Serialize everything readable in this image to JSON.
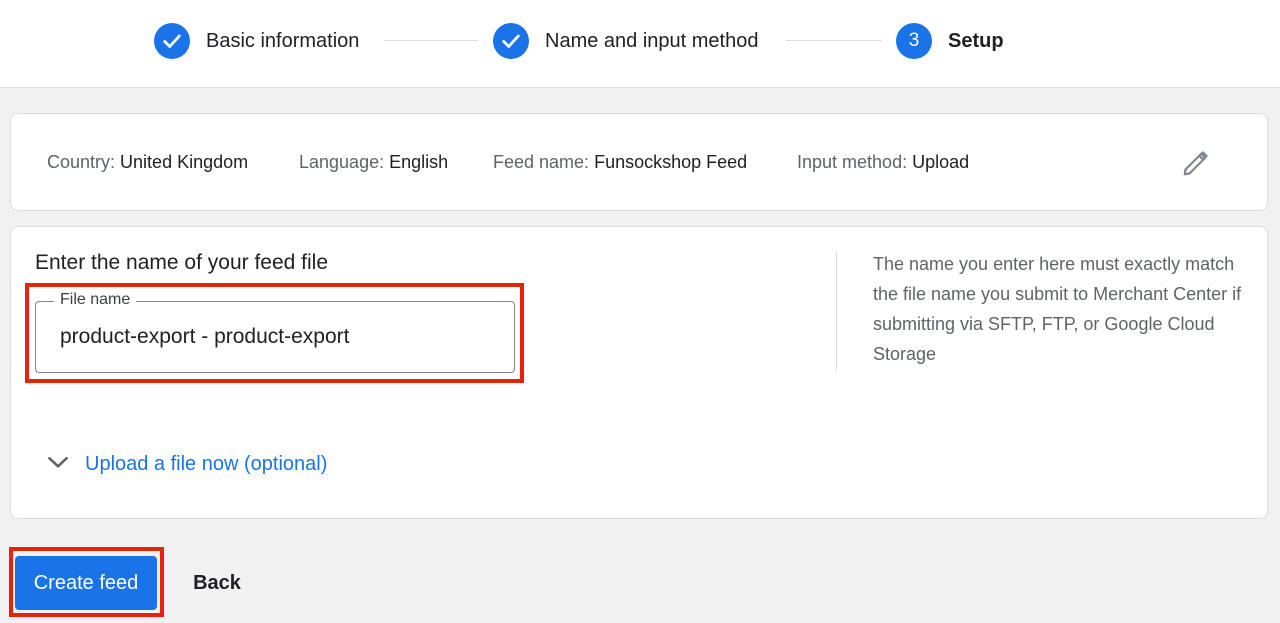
{
  "stepper": {
    "steps": [
      {
        "label": "Basic information",
        "state": "complete",
        "icon": "check-icon"
      },
      {
        "label": "Name and input method",
        "state": "complete",
        "icon": "check-icon"
      },
      {
        "label": "Setup",
        "number": "3",
        "state": "active"
      }
    ]
  },
  "summary": {
    "country": {
      "key": "Country:",
      "value": "United Kingdom"
    },
    "language": {
      "key": "Language:",
      "value": "English"
    },
    "feed_name": {
      "key": "Feed name:",
      "value": "Funsockshop Feed"
    },
    "input_method": {
      "key": "Input method:",
      "value": "Upload"
    },
    "edit_icon": "pencil-icon"
  },
  "main": {
    "title": "Enter the name of your feed file",
    "file_field": {
      "label": "File name",
      "value": "product-export - product-export"
    },
    "help_text": "The name you enter here must exactly match the file name you submit to Merchant Center if submitting via SFTP, FTP, or Google Cloud Storage",
    "expander": {
      "label": "Upload a file now (optional)",
      "icon": "chevron-down-icon"
    }
  },
  "actions": {
    "create_label": "Create feed",
    "back_label": "Back"
  },
  "colors": {
    "accent": "#1a73e8",
    "highlight": "#e8210b",
    "background": "#f1f1f1"
  }
}
